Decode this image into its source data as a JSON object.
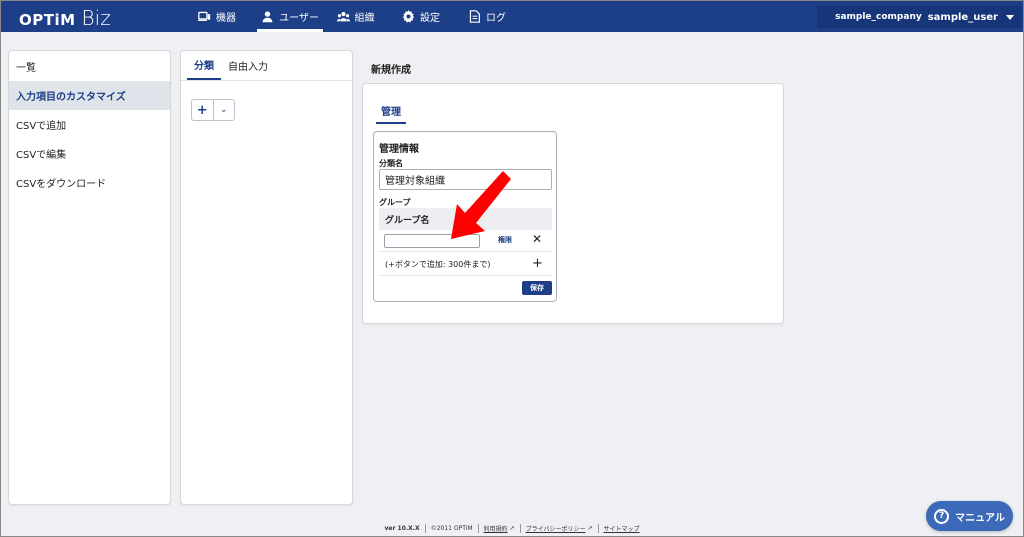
{
  "header": {
    "logo_optim": "OPTiM",
    "logo_biz": "Biz",
    "nav": [
      {
        "label": "機器",
        "icon": "devices-icon"
      },
      {
        "label": "ユーザー",
        "icon": "user-icon"
      },
      {
        "label": "組織",
        "icon": "organization-icon"
      },
      {
        "label": "設定",
        "icon": "settings-gear-icon"
      },
      {
        "label": "ログ",
        "icon": "log-document-icon"
      }
    ],
    "active_nav": "ユーザー",
    "company": "sample_company",
    "user": "sample_user"
  },
  "sidebar": {
    "items": [
      {
        "label": "一覧"
      },
      {
        "label": "入力項目のカスタマイズ"
      },
      {
        "label": "CSVで追加"
      },
      {
        "label": "CSVで編集"
      },
      {
        "label": "CSVをダウンロード"
      }
    ],
    "selected": "入力項目のカスタマイズ"
  },
  "middle": {
    "tabs": [
      {
        "label": "分類"
      },
      {
        "label": "自由入力"
      }
    ],
    "active_tab": "分類",
    "add_symbol": "+",
    "dropdown_symbol": "⌄"
  },
  "main": {
    "title": "新規作成",
    "tab": "管理",
    "card": {
      "title": "管理情報",
      "category_label": "分類名",
      "category_value": "管理対象組織",
      "group_label": "グループ",
      "table_header": "グループ名",
      "row_value": "",
      "permission_link": "権限",
      "remove_symbol": "✕",
      "hint": "(+ボタンで追加: 300件まで)",
      "add_symbol": "+",
      "save_label": "保存"
    }
  },
  "footer": {
    "version": "ver 10.X.X",
    "copyright": "©2011 OPTiM",
    "terms": "利用規約",
    "privacy": "プライバシーポリシー",
    "sitemap": "サイトマップ"
  },
  "manual_button": "マニュアル",
  "colors": {
    "primary": "#1d3f87",
    "arrow": "#ff0000",
    "manual": "#3d6ab8"
  }
}
